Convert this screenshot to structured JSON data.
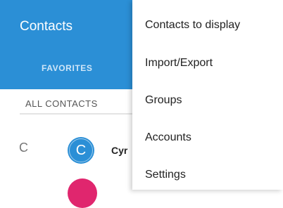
{
  "app_bar": {
    "title": "Contacts",
    "color": "#2b8fd6"
  },
  "tabs": [
    {
      "label": "FAVORITES",
      "selected": false
    },
    {
      "label": "ALL CONTACTS",
      "selected": true
    }
  ],
  "contacts": {
    "section_letter": "C",
    "items": [
      {
        "initial": "C",
        "name": "Cyr",
        "avatar_color": "#2b8fd6"
      },
      {
        "initial": "",
        "name": "",
        "avatar_color": "#e0266e"
      }
    ]
  },
  "overflow_menu": {
    "items": [
      {
        "label": "Contacts to display"
      },
      {
        "label": "Import/Export"
      },
      {
        "label": "Groups"
      },
      {
        "label": "Accounts"
      },
      {
        "label": "Settings"
      }
    ]
  }
}
